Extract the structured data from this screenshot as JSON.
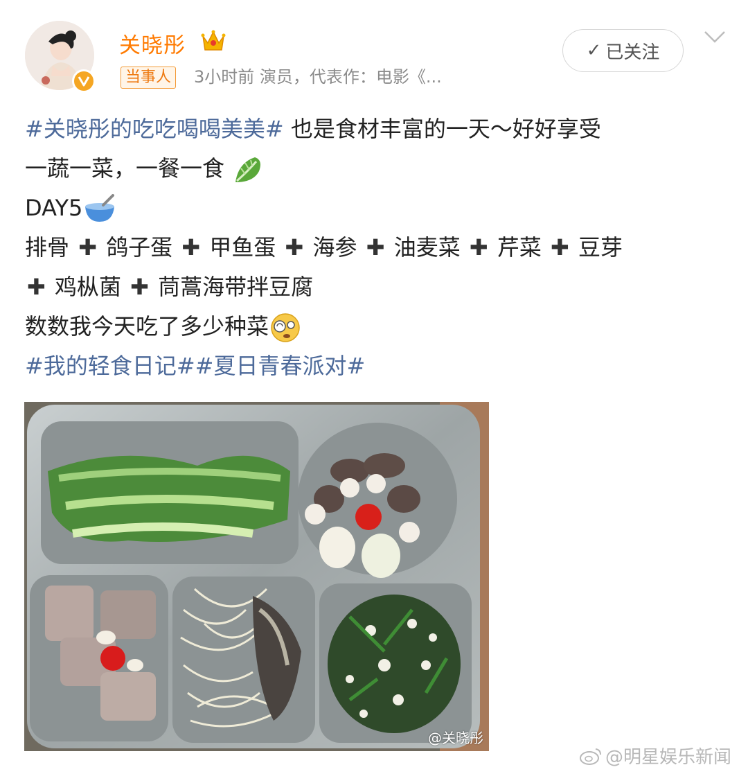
{
  "header": {
    "username": "关晓彤",
    "badge": "当事人",
    "meta": "3小时前  演员，代表作：电影《...",
    "follow_label": "已关注",
    "icons": [
      "crown-icon",
      "verified-icon",
      "chevron-down-icon"
    ]
  },
  "post": {
    "line1": {
      "hashtag": "#关晓彤的吃吃喝喝美美#",
      "text": " 也是食材丰富的一天～好好享受"
    },
    "line2": {
      "text": "一蔬一菜，一餐一食",
      "emoji": "lettuce-emoji"
    },
    "line3": {
      "text": "DAY5",
      "emoji": "bowl-emoji"
    },
    "ingredients": [
      "排骨",
      "鸽子蛋",
      "甲鱼蛋",
      "海参",
      "油麦菜",
      "芹菜",
      "豆芽",
      "鸡枞菌",
      "茼蒿海带拌豆腐"
    ],
    "line6": {
      "text": "数数我今天吃了多少种菜",
      "emoji": "dizzy-face-emoji"
    },
    "line7": {
      "hashtags": "#我的轻食日记##夏日青春派对#"
    }
  },
  "photo": {
    "watermark": "@关晓彤",
    "description": "food-tray-photo"
  },
  "source_watermark": "@明星娱乐新闻",
  "colors": {
    "username": "#ff7a00",
    "hashtag": "#4d6a9a",
    "meta": "#8b8b8b",
    "badge_border": "#f39a36"
  }
}
